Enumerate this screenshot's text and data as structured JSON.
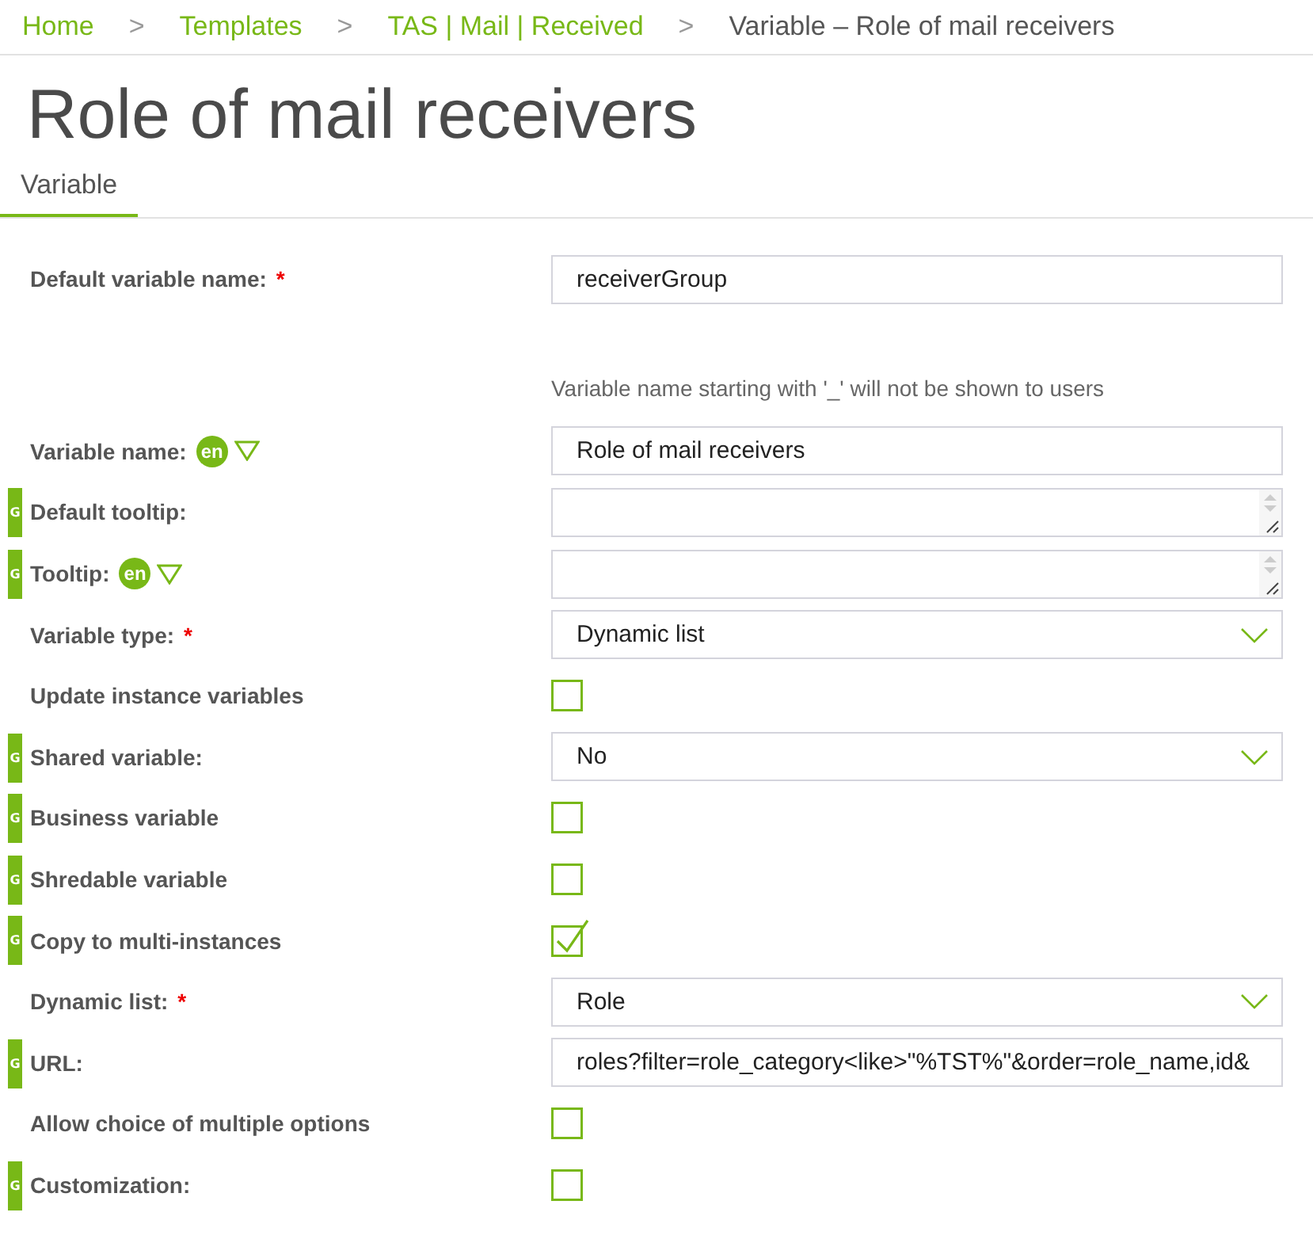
{
  "breadcrumb": {
    "separator": ">",
    "links": [
      "Home",
      "Templates",
      "TAS | Mail | Received"
    ],
    "current": "Variable – Role of mail receivers"
  },
  "title": "Role of mail receivers",
  "tabs": [
    {
      "label": "Variable",
      "selected": true
    }
  ],
  "rows": [
    {
      "label": "Default variable name:",
      "required_mark": "*",
      "kind": "text",
      "value": "receiverGroup",
      "hint": "Variable name starting with '_' will not be shown to users"
    },
    {
      "label": "Variable name:",
      "lang": "en",
      "kind": "text",
      "value": "Role of mail receivers"
    },
    {
      "label": "Default tooltip:",
      "badge": "G",
      "kind": "textarea"
    },
    {
      "label": "Tooltip:",
      "badge": "G",
      "lang": "en",
      "kind": "textarea"
    },
    {
      "label": "Variable type:",
      "required_mark": "*",
      "kind": "select",
      "value": "Dynamic list"
    },
    {
      "label": "Update instance variables",
      "kind": "checkbox",
      "checked": false
    },
    {
      "label": "Shared variable:",
      "badge": "G",
      "kind": "select",
      "value": "No"
    },
    {
      "label": "Business variable",
      "badge": "G",
      "kind": "checkbox",
      "checked": false
    },
    {
      "label": "Shredable variable",
      "badge": "G",
      "kind": "checkbox",
      "checked": false
    },
    {
      "label": "Copy to multi-instances",
      "badge": "G",
      "kind": "checkbox",
      "checked": true
    },
    {
      "label": "Dynamic list:",
      "required_mark": "*",
      "kind": "select",
      "value": "Role"
    },
    {
      "label": "URL:",
      "badge": "G",
      "kind": "text",
      "value": "roles?filter=role_category<like>\"%TST%\"&order=role_name,id&"
    },
    {
      "label": "Allow choice of multiple options",
      "kind": "checkbox",
      "checked": false
    },
    {
      "label": "Customization:",
      "badge": "G",
      "kind": "checkbox",
      "checked": false
    }
  ]
}
